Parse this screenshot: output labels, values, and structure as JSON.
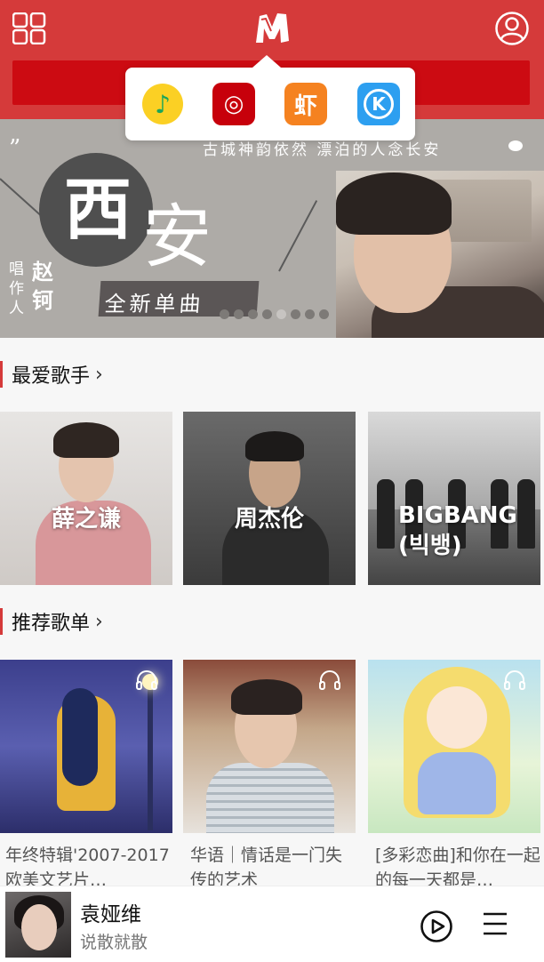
{
  "header": {
    "grid_icon": "grid-icon",
    "logo_icon": "m-logo-icon",
    "user_icon": "user-icon",
    "accent_color": "#d53a3a"
  },
  "popup": {
    "apps": [
      {
        "name": "qq-music-icon",
        "glyph": "♪"
      },
      {
        "name": "netease-music-icon",
        "glyph": "◎"
      },
      {
        "name": "xiami-music-icon",
        "glyph": "虾"
      },
      {
        "name": "kugou-music-icon",
        "glyph": "K"
      }
    ]
  },
  "banner": {
    "quote": "”",
    "tagline": "古城神韵依然 漂泊的人念长安",
    "title_1": "西",
    "title_2": "安",
    "credit_label": "唱作人",
    "credit_name": "赵钶",
    "new_single": "全新单曲",
    "dots_count": 8,
    "active_dot": 4
  },
  "sections": {
    "favorite_singers": {
      "title": "最爱歌手",
      "chevron": "›"
    },
    "recommended_playlists": {
      "title": "推荐歌单",
      "chevron": "›"
    }
  },
  "singers": [
    {
      "name": "薛之谦"
    },
    {
      "name": "周杰伦"
    },
    {
      "name": "BIGBANG\n(빅뱅)"
    }
  ],
  "playlists": [
    {
      "title": "年终特辑'2007-2017欧美文艺片…"
    },
    {
      "title": "华语｜情话是一门失传的艺术"
    },
    {
      "title": "[多彩恋曲]和你在一起的每一天都是…"
    }
  ],
  "player": {
    "title": "袁娅维",
    "subtitle": "说散就散",
    "play_icon": "play-circle-icon",
    "menu_icon": "menu-icon"
  }
}
